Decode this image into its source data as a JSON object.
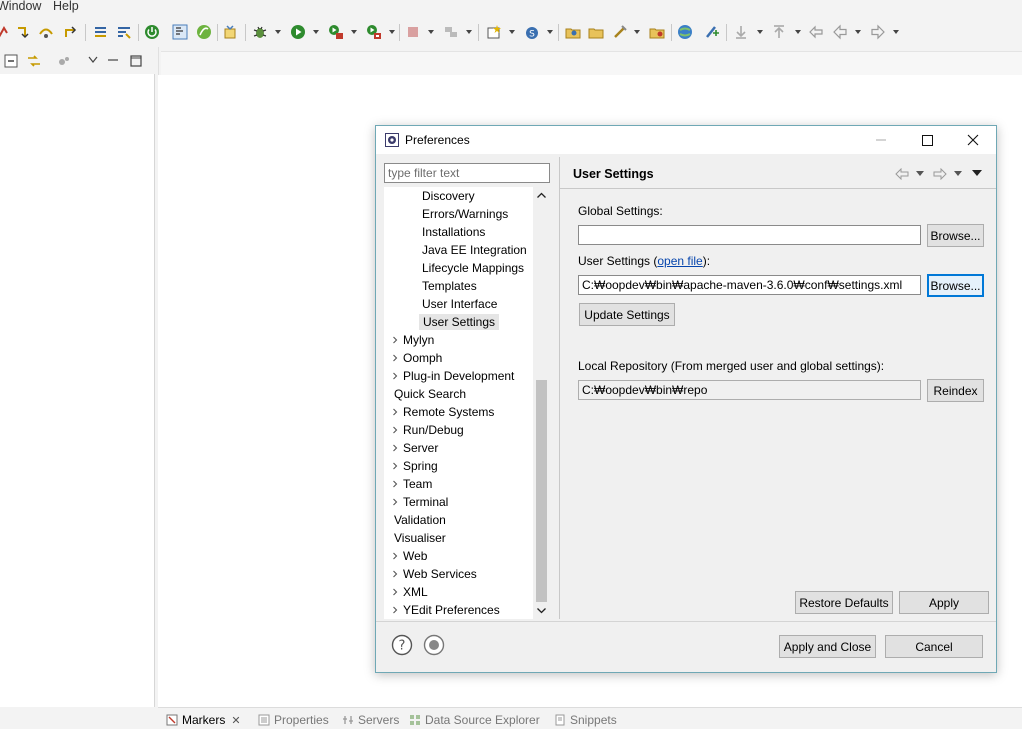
{
  "menubar": {
    "items": [
      "Window",
      "Help"
    ]
  },
  "editor": {
    "bottom_tabs": [
      {
        "label": "Markers",
        "active": true,
        "closable": true,
        "icon": "markers-icon"
      },
      {
        "label": "Properties",
        "active": false,
        "icon": "properties-icon"
      },
      {
        "label": "Servers",
        "active": false,
        "icon": "servers-icon"
      },
      {
        "label": "Data Source Explorer",
        "active": false,
        "icon": "data-source-icon"
      },
      {
        "label": "Snippets",
        "active": false,
        "icon": "snippets-icon"
      }
    ]
  },
  "dialog": {
    "title": "Preferences",
    "filter_placeholder": "type filter text",
    "tree": [
      {
        "label": "Discovery",
        "expandable": false
      },
      {
        "label": "Errors/Warnings",
        "expandable": false
      },
      {
        "label": "Installations",
        "expandable": false
      },
      {
        "label": "Java EE Integration",
        "expandable": false
      },
      {
        "label": "Lifecycle Mappings",
        "expandable": false
      },
      {
        "label": "Templates",
        "expandable": false
      },
      {
        "label": "User Interface",
        "expandable": false
      },
      {
        "label": "User Settings",
        "expandable": false,
        "selected": true
      },
      {
        "label": "Mylyn",
        "expandable": true
      },
      {
        "label": "Oomph",
        "expandable": true
      },
      {
        "label": "Plug-in Development",
        "expandable": true
      },
      {
        "label": "Quick Search",
        "expandable": false
      },
      {
        "label": "Remote Systems",
        "expandable": true
      },
      {
        "label": "Run/Debug",
        "expandable": true
      },
      {
        "label": "Server",
        "expandable": true
      },
      {
        "label": "Spring",
        "expandable": true
      },
      {
        "label": "Team",
        "expandable": true
      },
      {
        "label": "Terminal",
        "expandable": true
      },
      {
        "label": "Validation",
        "expandable": false
      },
      {
        "label": "Visualiser",
        "expandable": false
      },
      {
        "label": "Web",
        "expandable": true
      },
      {
        "label": "Web Services",
        "expandable": true
      },
      {
        "label": "XML",
        "expandable": true
      },
      {
        "label": "YEdit Preferences",
        "expandable": true
      }
    ],
    "page": {
      "title": "User Settings",
      "global_label": "Global Settings:",
      "global_value": "",
      "browse_label": "Browse...",
      "user_label_prefix": "User Settings (",
      "user_link": "open file",
      "user_label_suffix": "):",
      "user_value": "C:₩oopdev₩bin₩apache-maven-3.6.0₩conf₩settings.xml",
      "update_label": "Update Settings",
      "local_label": "Local Repository (From merged user and global settings):",
      "local_value": "C:₩oopdev₩bin₩repo",
      "reindex_label": "Reindex",
      "restore_label": "Restore Defaults",
      "apply_label": "Apply"
    },
    "footer": {
      "apply_close_label": "Apply and Close",
      "cancel_label": "Cancel"
    }
  }
}
